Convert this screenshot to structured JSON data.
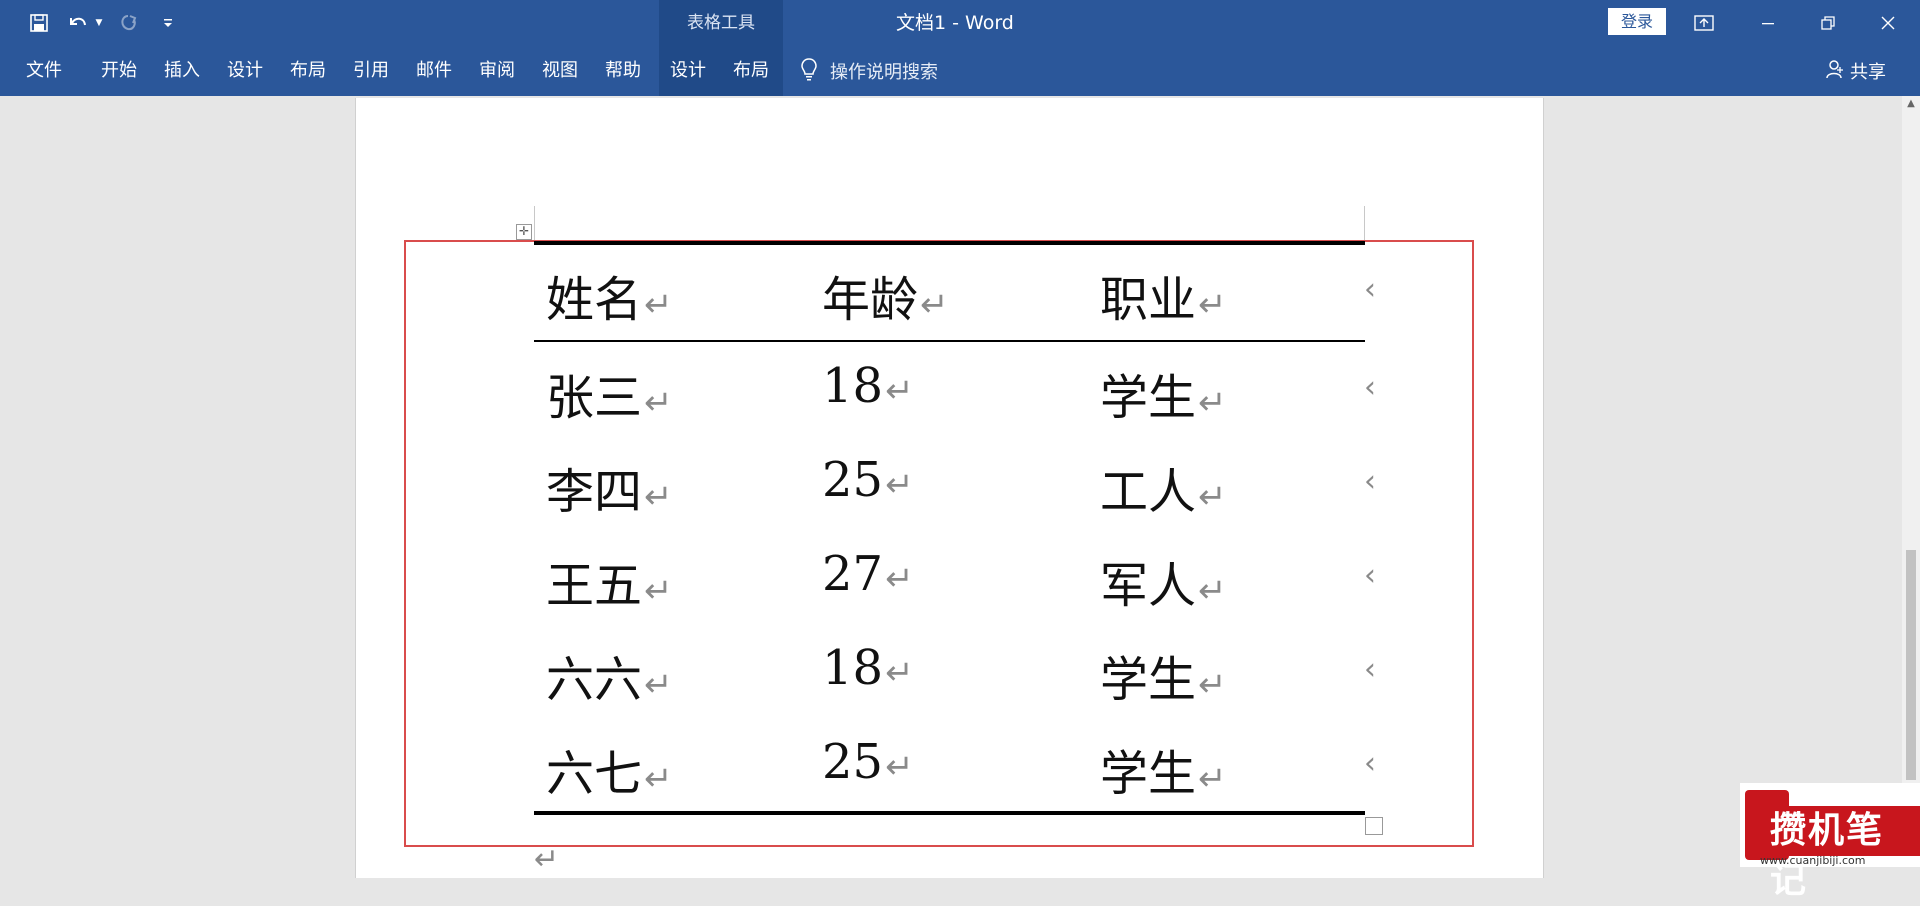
{
  "app": {
    "title": "文档1  -  Word",
    "contextual_group": "表格工具",
    "login_label": "登录",
    "accent_color": "#2b579a"
  },
  "quick_access": {
    "icons": [
      "save-icon",
      "undo-icon",
      "undo-dropdown-icon",
      "redo-icon",
      "customize-quick-access-icon"
    ]
  },
  "window_controls": {
    "icons": [
      "ribbon-display-options-icon",
      "minimize-icon",
      "restore-icon",
      "close-icon"
    ]
  },
  "ribbon": {
    "tabs": [
      "文件",
      "开始",
      "插入",
      "设计",
      "布局",
      "引用",
      "邮件",
      "审阅",
      "视图",
      "帮助",
      "设计",
      "布局"
    ],
    "tell_me": "操作说明搜索",
    "share": "共享"
  },
  "table": {
    "headers": [
      "姓名",
      "年龄",
      "职业"
    ],
    "rows": [
      [
        "张三",
        "18",
        "学生"
      ],
      [
        "李四",
        "25",
        "工人"
      ],
      [
        "王五",
        "27",
        "军人"
      ],
      [
        "六六",
        "18",
        "学生"
      ],
      [
        "六七",
        "25",
        "学生"
      ]
    ],
    "paragraph_mark": "↵"
  },
  "watermark": {
    "text": "攒机笔记",
    "url": "www.cuanjibiji.com",
    "color": "#c8161d"
  }
}
